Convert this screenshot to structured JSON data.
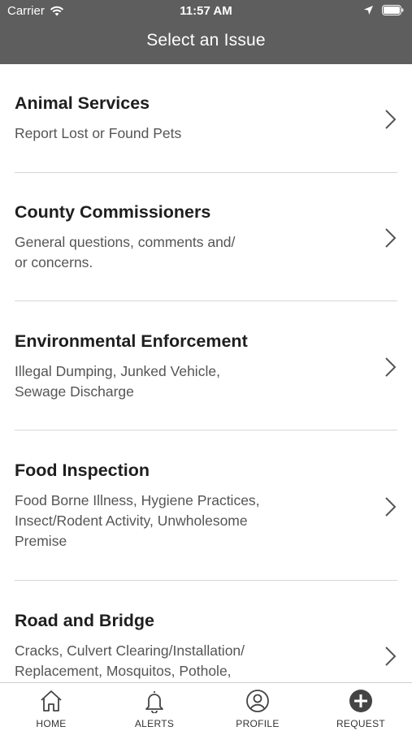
{
  "status_bar": {
    "carrier": "Carrier",
    "time": "11:57 AM"
  },
  "header": {
    "title": "Select an Issue"
  },
  "issues": [
    {
      "title": "Animal Services",
      "description": "Report Lost or Found Pets"
    },
    {
      "title": "County Commissioners",
      "description": "General questions, comments and/\nor concerns."
    },
    {
      "title": "Environmental Enforcement",
      "description": "Illegal Dumping, Junked Vehicle,\nSewage Discharge"
    },
    {
      "title": "Food Inspection",
      "description": "Food Borne Illness, Hygiene Practices,\nInsect/Rodent Activity, Unwholesome\nPremise"
    },
    {
      "title": "Road and Bridge",
      "description": "Cracks, Culvert Clearing/Installation/\nReplacement, Mosquitos, Pothole,"
    }
  ],
  "tabs": [
    {
      "label": "HOME",
      "icon": "home-icon"
    },
    {
      "label": "ALERTS",
      "icon": "bell-icon"
    },
    {
      "label": "PROFILE",
      "icon": "profile-icon"
    },
    {
      "label": "REQUEST",
      "icon": "plus-circle-icon"
    }
  ],
  "colors": {
    "header_bg": "#5e5e5e",
    "divider": "#d6d6d6",
    "icon": "#444444"
  }
}
